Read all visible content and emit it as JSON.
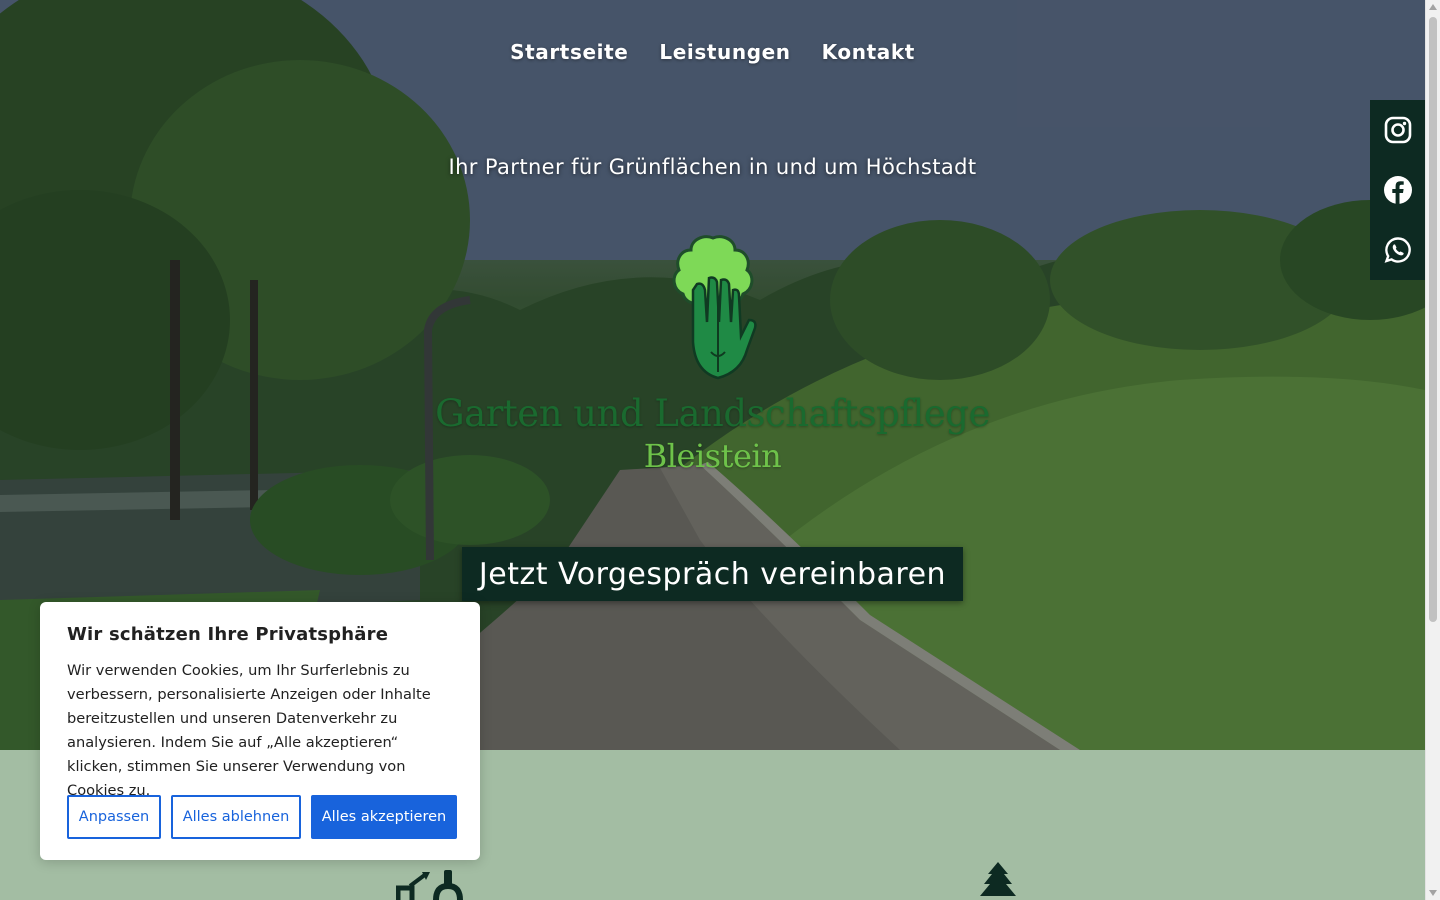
{
  "nav": {
    "items": [
      {
        "label": "Startseite"
      },
      {
        "label": "Leistungen"
      },
      {
        "label": "Kontakt"
      }
    ]
  },
  "hero": {
    "tagline": "Ihr Partner für Grünflächen in und um Höchstadt",
    "logo_title": "Garten und Landschaftspflege",
    "logo_subtitle": "Bleistein",
    "cta_label": "Jetzt Vorgespräch vereinbaren"
  },
  "social": {
    "items": [
      {
        "icon": "instagram-icon"
      },
      {
        "icon": "facebook-icon"
      },
      {
        "icon": "whatsapp-icon"
      }
    ]
  },
  "cookie": {
    "title": "Wir schätzen Ihre Privatsphäre",
    "text": "Wir verwenden Cookies, um Ihr Surferlebnis zu verbessern, personalisierte Anzeigen oder Inhalte bereitzustellen und unseren Datenverkehr zu analysieren. Indem Sie auf „Alle akzeptieren“ klicken, stimmen Sie unserer Verwendung von Cookies zu.",
    "customize_label": "Anpassen",
    "reject_label": "Alles ablehnen",
    "accept_label": "Alles akzeptieren"
  },
  "colors": {
    "cta_bg": "#0d2a22",
    "section_bg": "#a3bda3",
    "cookie_accent": "#1863dc",
    "logo_green_dark": "#1a6a2f",
    "logo_green_light": "#6ec24a"
  }
}
